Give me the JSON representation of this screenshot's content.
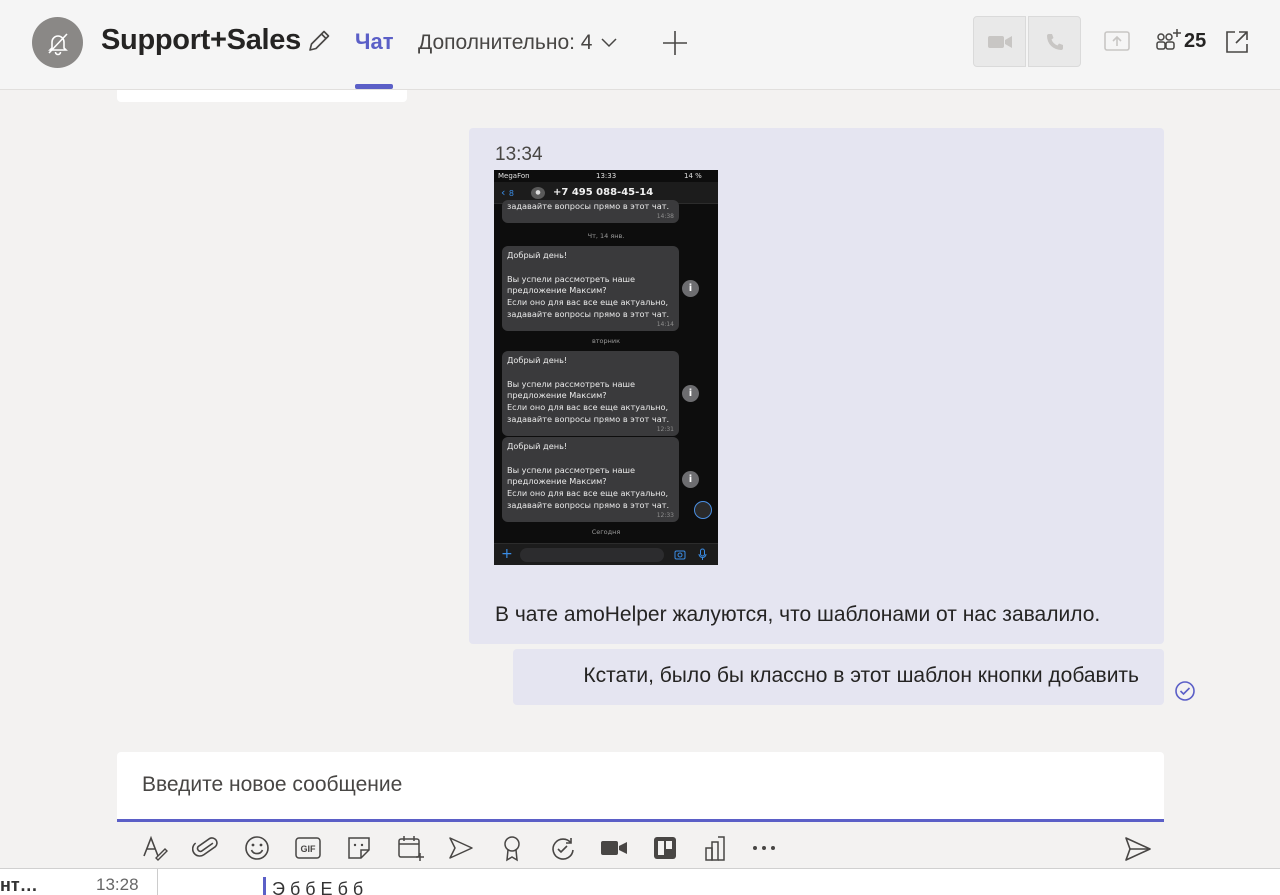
{
  "header": {
    "title": "Support+Sales",
    "tab_chat": "Чат",
    "tab_more": "Дополнительно: 4",
    "participants_count": "25"
  },
  "messages": {
    "time": "13:34",
    "text": "В чате amoHelper жалуются, что шаблонами от нас завалило.",
    "followup": "Кстати, было бы классно в этот шаблон кнопки добавить"
  },
  "phone": {
    "carrier": "MegaFon",
    "clock": "13:33",
    "battery": "14 %",
    "back_label": "8",
    "number": "+7 495 088-45-14",
    "top_fragment": "задавайте вопросы прямо в этот чат.",
    "top_fragment_time": "14:38",
    "date1": "Чт, 14 янв.",
    "date2": "вторник",
    "date3": "Сегодня",
    "bubbles": [
      {
        "lines": [
          "Добрый день!",
          "",
          "Вы успели рассмотреть наше",
          "предложение Максим?",
          "Если оно для вас все еще актуально,",
          "задавайте вопросы прямо в этот чат."
        ],
        "time": "14:14"
      },
      {
        "lines": [
          "Добрый день!",
          "",
          "Вы успели рассмотреть наше",
          "предложение Максим?",
          "Если оно для вас все еще актуально,",
          "задавайте вопросы прямо в этот чат."
        ],
        "time": "12:31"
      },
      {
        "lines": [
          "Добрый день!",
          "",
          "Вы успели рассмотреть наше",
          "предложение Максим?",
          "Если оно для вас все еще актуально,",
          "задавайте вопросы прямо в этот чат."
        ],
        "time": "12:33"
      }
    ]
  },
  "compose": {
    "placeholder": "Введите новое сообщение"
  },
  "toolbar_icons": [
    "format-icon",
    "attach-icon",
    "emoji-icon",
    "gif-icon",
    "sticker-icon",
    "schedule-meeting-icon",
    "stream-icon",
    "praise-icon",
    "loop-icon",
    "video-app-icon",
    "trello-icon",
    "analytics-icon",
    "more-icon"
  ],
  "bottom_strip": {
    "left_text": "нт…",
    "time": "13:28",
    "text": "Э                    б                  б                  Е                                        б                             б"
  },
  "colors": {
    "accent": "#5b5fc7",
    "bubble_bg": "#e5e5f1",
    "page_bg": "#f3f2f1"
  }
}
